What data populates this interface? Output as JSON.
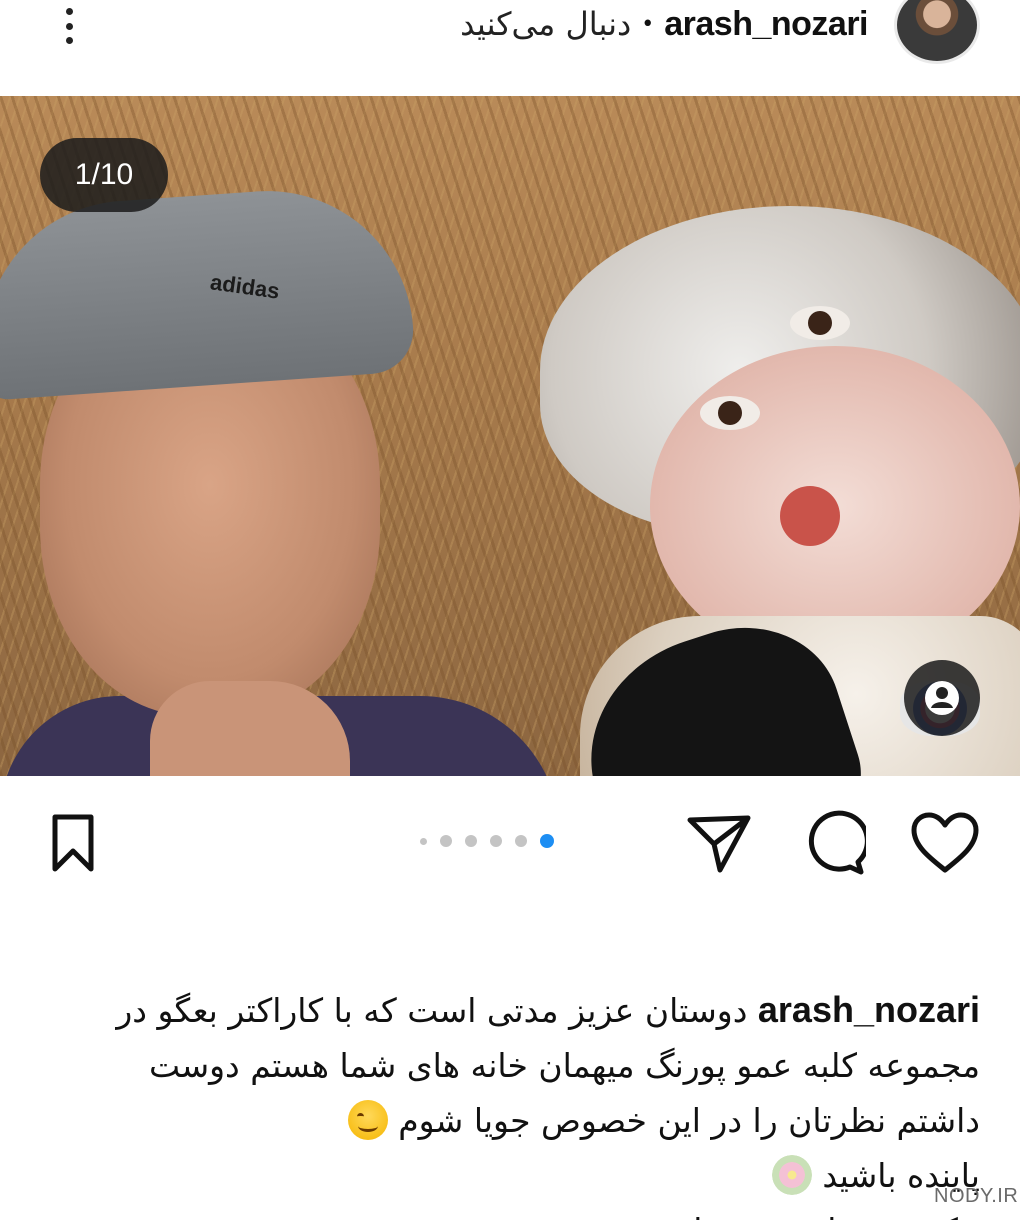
{
  "header": {
    "username": "arash_nozari",
    "separator": "•",
    "follow_status": "دنبال می‌کنید",
    "more_icon": "more-vertical-icon"
  },
  "post": {
    "counter": "1/10",
    "slide_index": 1,
    "slide_total": 10,
    "cap_brand_text": "adidas",
    "tag_icon": "user-tag-icon"
  },
  "actions": {
    "icons": [
      "heart-icon",
      "comment-icon",
      "share-icon",
      "bookmark-icon"
    ],
    "active_dot_color": "#1d8ef3"
  },
  "caption": {
    "username": "arash_nozari",
    "line1": "دوستان عزیز مدتی است که با کاراکتر بعگو در",
    "line2": "مجموعه کلبه عمو پورنگ میهمان خانه های شما هستم دوست",
    "line3": "داشتم نظرتان را در این خصوص جویا شوم",
    "line4": "پاینده باشید",
    "line5": "عکس: رویا منوچهرزاده"
  },
  "watermark": {
    "text": "NODY.IR"
  }
}
